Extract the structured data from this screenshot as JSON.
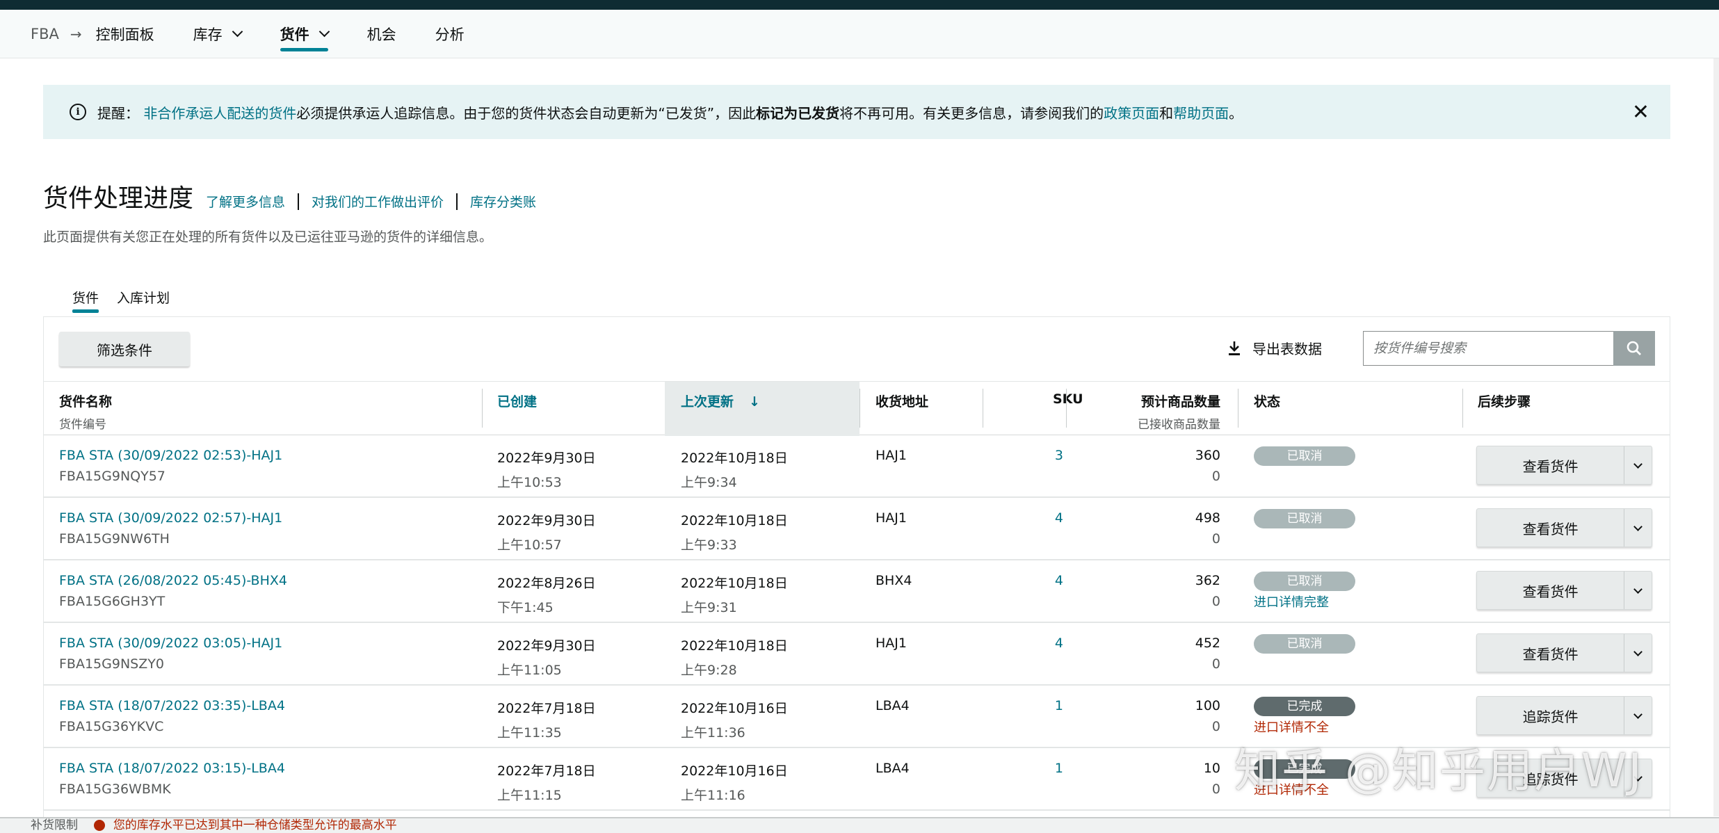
{
  "nav": {
    "fba": "FBA",
    "items": [
      {
        "label": "控制面板",
        "dropdown": false,
        "active": false
      },
      {
        "label": "库存",
        "dropdown": true,
        "active": false
      },
      {
        "label": "货件",
        "dropdown": true,
        "active": true
      },
      {
        "label": "机会",
        "dropdown": false,
        "active": false
      },
      {
        "label": "分析",
        "dropdown": false,
        "active": false
      }
    ]
  },
  "alert": {
    "prefix": "提醒：",
    "link1": "非合作承运人配送的货件",
    "text1": "必须提供承运人追踪信息。由于您的货件状态会自动更新为“已发货”，因此",
    "bold": "标记为已发货",
    "text2": "将不再可用。有关更多信息，请参阅我们的",
    "link2": "政策页面",
    "text3": "和",
    "link3": "帮助页面",
    "text4": "。"
  },
  "page": {
    "title": "货件处理进度",
    "links": [
      "了解更多信息",
      "对我们的工作做出评价",
      "库存分类账"
    ],
    "subtitle": "此页面提供有关您正在处理的所有货件以及已运往亚马逊的货件的详细信息。"
  },
  "tabs": [
    {
      "label": "货件",
      "active": true
    },
    {
      "label": "入库计划",
      "active": false
    }
  ],
  "toolbar": {
    "filter_label": "筛选条件",
    "export_label": "导出表数据",
    "search_placeholder": "按货件编号搜索"
  },
  "table": {
    "headers": {
      "name": "货件名称",
      "name_sub": "货件编号",
      "created": "已创建",
      "updated": "上次更新",
      "address": "收货地址",
      "sku": "SKU",
      "qty": "预计商品数量",
      "qty_sub": "已接收商品数量",
      "status": "状态",
      "next": "后续步骤"
    },
    "rows": [
      {
        "name": "FBA STA (30/09/2022 02:53)-HAJ1",
        "id": "FBA15G9NQY57",
        "created_date": "2022年9月30日",
        "created_time": "上午10:53",
        "updated_date": "2022年10月18日",
        "updated_time": "上午9:34",
        "address": "HAJ1",
        "sku": "3",
        "qty_expected": "360",
        "qty_received": "0",
        "status": "已取消",
        "status_type": "cancel",
        "status_note": "",
        "note_type": "",
        "action": "查看货件"
      },
      {
        "name": "FBA STA (30/09/2022 02:57)-HAJ1",
        "id": "FBA15G9NW6TH",
        "created_date": "2022年9月30日",
        "created_time": "上午10:57",
        "updated_date": "2022年10月18日",
        "updated_time": "上午9:33",
        "address": "HAJ1",
        "sku": "4",
        "qty_expected": "498",
        "qty_received": "0",
        "status": "已取消",
        "status_type": "cancel",
        "status_note": "",
        "note_type": "",
        "action": "查看货件"
      },
      {
        "name": "FBA STA (26/08/2022 05:45)-BHX4",
        "id": "FBA15G6GH3YT",
        "created_date": "2022年8月26日",
        "created_time": "下午1:45",
        "updated_date": "2022年10月18日",
        "updated_time": "上午9:31",
        "address": "BHX4",
        "sku": "4",
        "qty_expected": "362",
        "qty_received": "0",
        "status": "已取消",
        "status_type": "cancel",
        "status_note": "进口详情完整",
        "note_type": "ok",
        "action": "查看货件"
      },
      {
        "name": "FBA STA (30/09/2022 03:05)-HAJ1",
        "id": "FBA15G9NSZY0",
        "created_date": "2022年9月30日",
        "created_time": "上午11:05",
        "updated_date": "2022年10月18日",
        "updated_time": "上午9:28",
        "address": "HAJ1",
        "sku": "4",
        "qty_expected": "452",
        "qty_received": "0",
        "status": "已取消",
        "status_type": "cancel",
        "status_note": "",
        "note_type": "",
        "action": "查看货件"
      },
      {
        "name": "FBA STA (18/07/2022 03:35)-LBA4",
        "id": "FBA15G36YKVC",
        "created_date": "2022年7月18日",
        "created_time": "上午11:35",
        "updated_date": "2022年10月16日",
        "updated_time": "上午11:36",
        "address": "LBA4",
        "sku": "1",
        "qty_expected": "100",
        "qty_received": "0",
        "status": "已完成",
        "status_type": "done",
        "status_note": "进口详情不全",
        "note_type": "warn",
        "action": "追踪货件"
      },
      {
        "name": "FBA STA (18/07/2022 03:15)-LBA4",
        "id": "FBA15G36WBMK",
        "created_date": "2022年7月18日",
        "created_time": "上午11:15",
        "updated_date": "2022年10月16日",
        "updated_time": "上午11:16",
        "address": "LBA4",
        "sku": "1",
        "qty_expected": "10",
        "qty_received": "0",
        "status": "已完成",
        "status_type": "done",
        "status_note": "进口详情不全",
        "note_type": "warn",
        "action": "追踪货件"
      }
    ]
  },
  "bottom": {
    "label": "补货限制",
    "warning": "您的库存水平已达到其中一种仓储类型允许的最高水平"
  },
  "watermark": "知乎 @知乎用户WJ"
}
